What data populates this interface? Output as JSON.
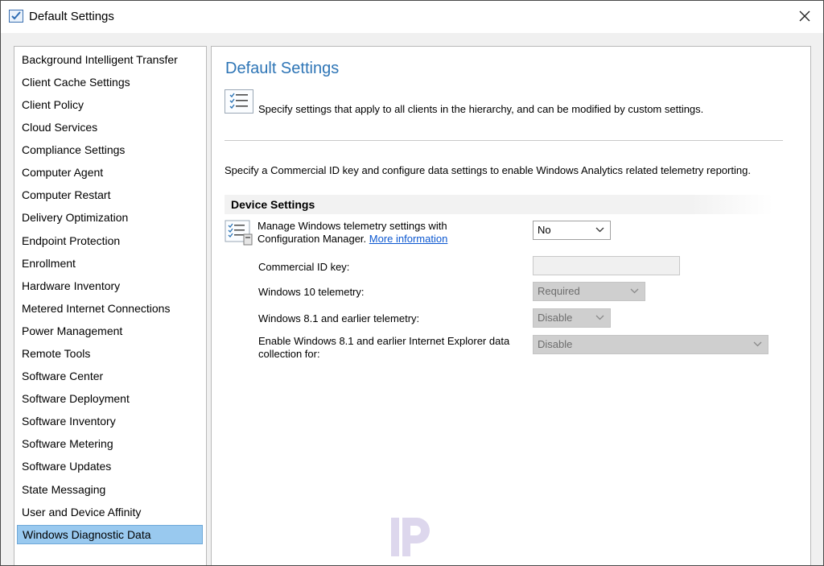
{
  "window": {
    "title": "Default Settings"
  },
  "sidebar": {
    "items": [
      {
        "label": "Background Intelligent Transfer"
      },
      {
        "label": "Client Cache Settings"
      },
      {
        "label": "Client Policy"
      },
      {
        "label": "Cloud Services"
      },
      {
        "label": "Compliance Settings"
      },
      {
        "label": "Computer Agent"
      },
      {
        "label": "Computer Restart"
      },
      {
        "label": "Delivery Optimization"
      },
      {
        "label": "Endpoint Protection"
      },
      {
        "label": "Enrollment"
      },
      {
        "label": "Hardware Inventory"
      },
      {
        "label": "Metered Internet Connections"
      },
      {
        "label": "Power Management"
      },
      {
        "label": "Remote Tools"
      },
      {
        "label": "Software Center"
      },
      {
        "label": "Software Deployment"
      },
      {
        "label": "Software Inventory"
      },
      {
        "label": "Software Metering"
      },
      {
        "label": "Software Updates"
      },
      {
        "label": "State Messaging"
      },
      {
        "label": "User and Device Affinity"
      },
      {
        "label": "Windows Diagnostic Data",
        "selected": true
      }
    ]
  },
  "main": {
    "title": "Default Settings",
    "description": "Specify settings that apply to all clients in the hierarchy, and can be modified by custom settings.",
    "intro": "Specify a Commercial ID key and configure data settings to enable Windows Analytics related telemetry reporting.",
    "group_title": "Device Settings",
    "manage": {
      "label_line1": "Manage Windows telemetry settings with",
      "label_line2": "Configuration Manager.",
      "link": "More information",
      "value": "No"
    },
    "commercial_id": {
      "label": "Commercial ID key:",
      "value": ""
    },
    "win10_telemetry": {
      "label": "Windows 10 telemetry:",
      "value": "Required"
    },
    "win81_telemetry": {
      "label": "Windows 8.1 and earlier telemetry:",
      "value": "Disable"
    },
    "ie_collection": {
      "label_line1": "Enable Windows 8.1 and earlier Internet Explorer data",
      "label_line2": "collection for:",
      "value": "Disable"
    }
  },
  "colors": {
    "accent_title": "#2e75b6",
    "selected_item": "#99c9ef",
    "link": "#0b57d0",
    "disabled_field": "#cfcfcf"
  },
  "icons": [
    "settings-app-icon",
    "close-icon",
    "checklist-icon",
    "chevron-down-icon",
    "watermark-logo"
  ]
}
